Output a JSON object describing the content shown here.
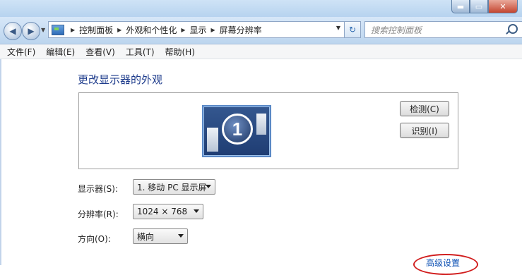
{
  "window": {
    "controls": {
      "minimize": "▬",
      "maximize": "▭",
      "close": "✕"
    }
  },
  "navigation": {
    "back_glyph": "◀",
    "forward_glyph": "▶",
    "breadcrumbs": [
      "控制面板",
      "外观和个性化",
      "显示",
      "屏幕分辨率"
    ],
    "refresh_glyph": "↻",
    "search_placeholder": "搜索控制面板"
  },
  "menu": {
    "items": [
      "文件(F)",
      "编辑(E)",
      "查看(V)",
      "工具(T)",
      "帮助(H)"
    ]
  },
  "main": {
    "heading": "更改显示器的外观",
    "monitor_number": "1",
    "detect_button": "检测(C)",
    "identify_button": "识别(I)",
    "display_label": "显示器(S):",
    "display_value": "1. 移动 PC 显示屏",
    "resolution_label": "分辨率(R):",
    "resolution_value": "1024 × 768",
    "orientation_label": "方向(O):",
    "orientation_value": "横向",
    "advanced_link": "高级设置"
  },
  "colors": {
    "heading": "#1e3c8c",
    "link": "#0b4fb3",
    "highlight_ring": "#d11d1d"
  },
  "icons": [
    "back-arrow-icon",
    "forward-arrow-icon",
    "control-panel-icon",
    "refresh-icon",
    "search-icon",
    "monitor-icon"
  ]
}
